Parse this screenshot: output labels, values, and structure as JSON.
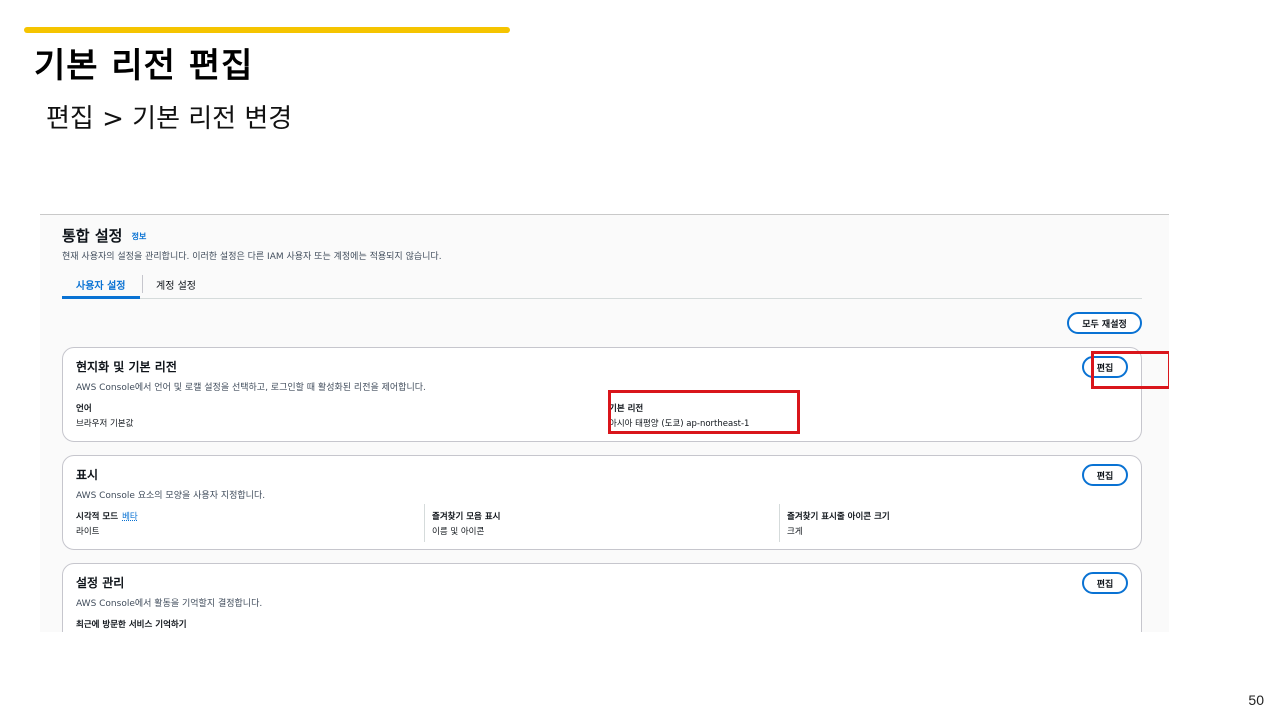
{
  "slide": {
    "title": "기본 리전 편집",
    "subtitle": "편집 > 기본 리전 변경",
    "page_number": "50",
    "accent_color": "#f5c400"
  },
  "settings": {
    "title": "통합 설정",
    "info_link": "정보",
    "description": "현재 사용자의 설정을 관리합니다. 이러한 설정은 다른 IAM 사용자 또는 계정에는 적용되지 않습니다.",
    "tabs": [
      {
        "label": "사용자 설정",
        "active": true
      },
      {
        "label": "계정 설정",
        "active": false
      }
    ],
    "reset_all_label": "모두 재설정"
  },
  "cards": [
    {
      "title": "현지화 및 기본 리전",
      "description": "AWS Console에서 언어 및 로캘 설정을 선택하고, 로그인할 때 활성화된 리전을 제어합니다.",
      "edit_label": "편집",
      "fields": [
        {
          "label": "언어",
          "value": "브라우저 기본값"
        },
        {
          "label": "기본 리전",
          "value": "아시아 태평양 (도쿄) ap-northeast-1"
        }
      ]
    },
    {
      "title": "표시",
      "description": "AWS Console 요소의 모양을 사용자 지정합니다.",
      "edit_label": "편집",
      "fields": [
        {
          "label": "시각적 모드",
          "badge": "베타",
          "value": "라이트"
        },
        {
          "label": "즐겨찾기 모음 표시",
          "value": "이름 및 아이콘"
        },
        {
          "label": "즐겨찾기 표시줄 아이콘 크기",
          "value": "크게"
        }
      ]
    },
    {
      "title": "설정 관리",
      "description": "AWS Console에서 활동을 기억할지 결정합니다.",
      "edit_label": "편집",
      "fields": [
        {
          "label": "최근에 방문한 서비스 기억하기",
          "value": ""
        }
      ]
    }
  ],
  "colors": {
    "link_blue": "#0972d3",
    "highlight_red": "#d9151b",
    "card_border": "#c6c6cd"
  }
}
